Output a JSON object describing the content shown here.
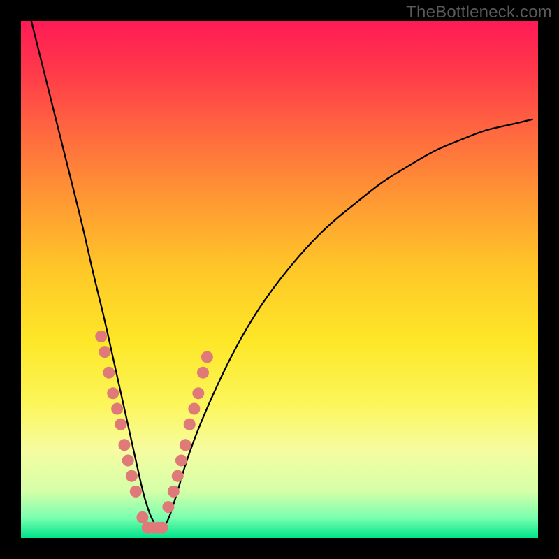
{
  "watermark": "TheBottleneck.com",
  "chart_data": {
    "type": "line",
    "title": "",
    "xlabel": "",
    "ylabel": "",
    "xlim": [
      0,
      100
    ],
    "ylim": [
      0,
      100
    ],
    "curve": {
      "comment": "V-shaped bottleneck curve; y represents mismatch/bottleneck amount, minimum ~0 around x≈25",
      "x": [
        2,
        5,
        8,
        10,
        12,
        14,
        16,
        18,
        20,
        22,
        24,
        26,
        28,
        30,
        32,
        35,
        40,
        45,
        50,
        55,
        60,
        65,
        70,
        75,
        80,
        85,
        90,
        95,
        99
      ],
      "y": [
        100,
        88,
        76,
        68,
        60,
        51,
        43,
        34,
        25,
        16,
        7,
        2,
        2,
        8,
        15,
        23,
        34,
        43,
        50,
        56,
        61,
        65,
        69,
        72,
        75,
        77,
        79,
        80,
        81
      ]
    },
    "scatter": {
      "comment": "Highlighted sample points lying on the curve near the trough",
      "points": [
        {
          "x": 15.5,
          "y": 39
        },
        {
          "x": 16.2,
          "y": 36
        },
        {
          "x": 17.0,
          "y": 32
        },
        {
          "x": 17.8,
          "y": 28
        },
        {
          "x": 18.6,
          "y": 25
        },
        {
          "x": 19.3,
          "y": 22
        },
        {
          "x": 20.0,
          "y": 18
        },
        {
          "x": 20.7,
          "y": 15
        },
        {
          "x": 21.4,
          "y": 12
        },
        {
          "x": 22.2,
          "y": 9
        },
        {
          "x": 23.5,
          "y": 4
        },
        {
          "x": 24.5,
          "y": 2
        },
        {
          "x": 25.5,
          "y": 2
        },
        {
          "x": 26.5,
          "y": 2
        },
        {
          "x": 27.3,
          "y": 2
        },
        {
          "x": 28.5,
          "y": 6
        },
        {
          "x": 29.5,
          "y": 9
        },
        {
          "x": 30.3,
          "y": 12
        },
        {
          "x": 31.0,
          "y": 15
        },
        {
          "x": 31.8,
          "y": 18
        },
        {
          "x": 32.6,
          "y": 22
        },
        {
          "x": 33.5,
          "y": 25
        },
        {
          "x": 34.3,
          "y": 28
        },
        {
          "x": 35.2,
          "y": 32
        },
        {
          "x": 36.0,
          "y": 35
        }
      ]
    }
  }
}
